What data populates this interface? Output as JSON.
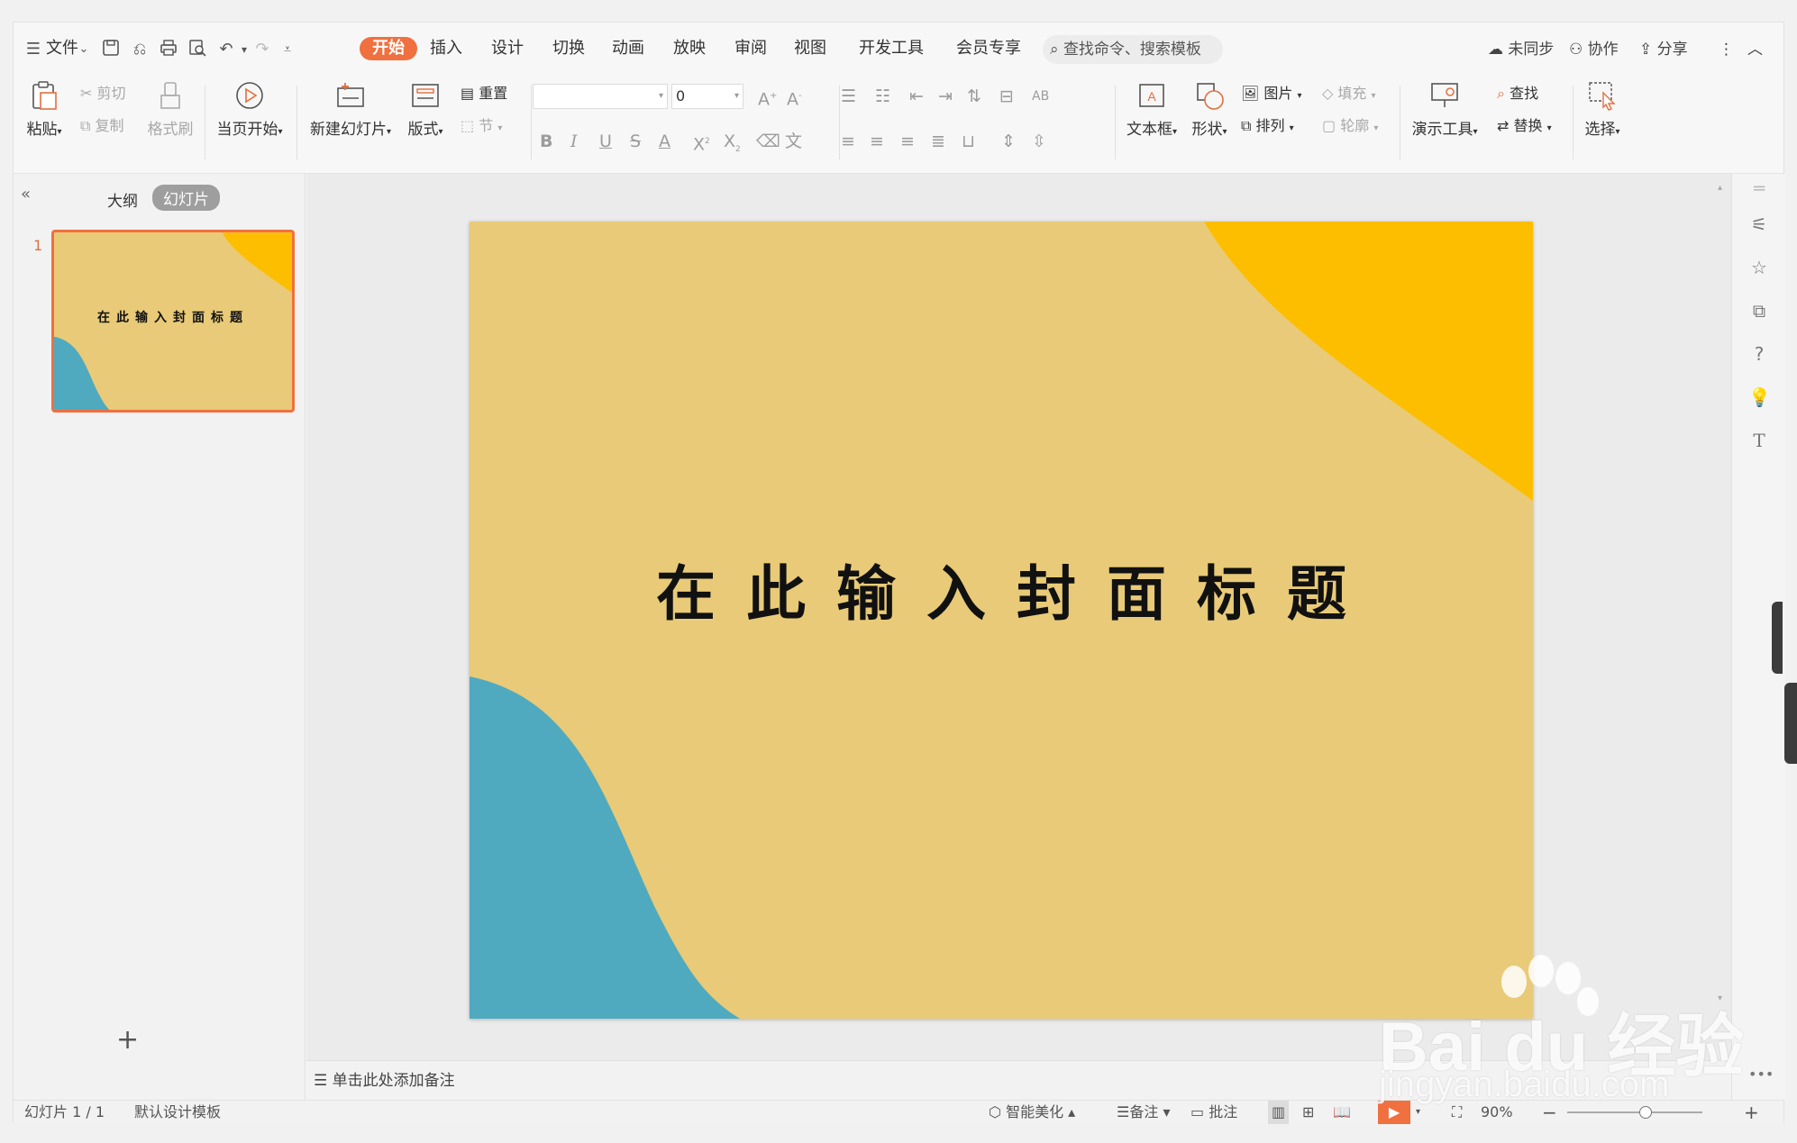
{
  "menubar": {
    "file_label": "文件",
    "tabs": [
      "开始",
      "插入",
      "设计",
      "切换",
      "动画",
      "放映",
      "审阅",
      "视图",
      "开发工具",
      "会员专享"
    ],
    "active_tab": "开始",
    "search_placeholder": "查找命令、搜索模板",
    "sync_label": "未同步",
    "collab_label": "协作",
    "share_label": "分享"
  },
  "ribbon": {
    "paste": "粘贴",
    "cut": "剪切",
    "copy": "复制",
    "format_painter": "格式刷",
    "play_from_current": "当页开始",
    "new_slide": "新建幻灯片",
    "layout": "版式",
    "reset": "重置",
    "section": "节",
    "font_size": "0",
    "text_box": "文本框",
    "shape": "形状",
    "picture": "图片",
    "fill": "填充",
    "arrange": "排列",
    "outline": "轮廓",
    "presentation_tools": "演示工具",
    "find": "查找",
    "replace": "替换",
    "select": "选择"
  },
  "left_panel": {
    "outline_tab": "大纲",
    "slides_tab": "幻灯片",
    "slide_number": "1",
    "thumb_title": "在此输入封面标题"
  },
  "slide": {
    "title": "在此输入封面标题",
    "bg_color": "#e8ca78",
    "accent_yellow": "#fdbe00",
    "accent_blue": "#4faabf"
  },
  "notes": {
    "placeholder": "单击此处添加备注"
  },
  "status": {
    "slide_info": "幻灯片 1 / 1",
    "template": "默认设计模板",
    "smart_beautify": "智能美化",
    "notes": "备注",
    "comments": "批注",
    "zoom": "90%"
  },
  "watermark": {
    "brand": "Bai du 经验",
    "url": "jingyan.baidu.com"
  },
  "accent_color": "#f0703f"
}
